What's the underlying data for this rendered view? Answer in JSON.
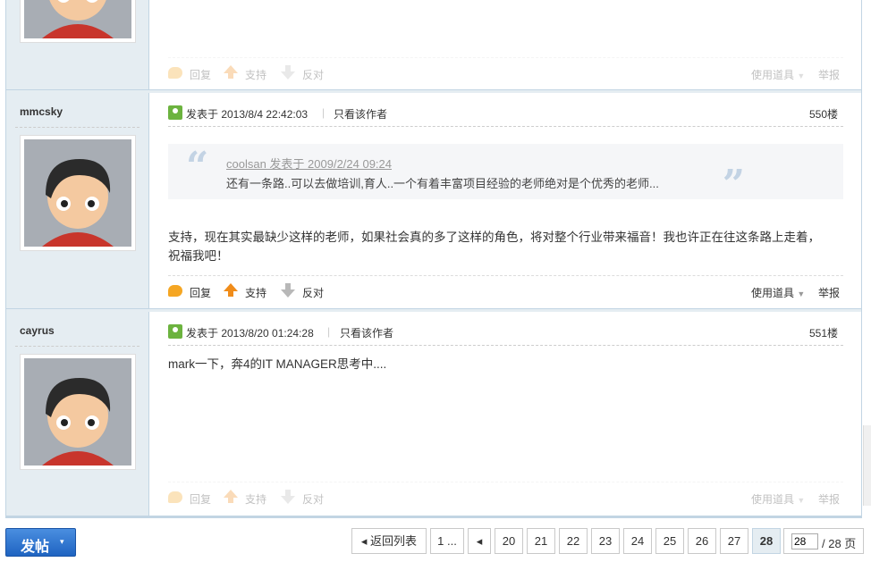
{
  "post_prev": {
    "actions": {
      "reply": "回复",
      "support": "支持",
      "oppose": "反对",
      "tools": "使用道具",
      "report": "举报"
    }
  },
  "post_550": {
    "author": "mmcsky",
    "posted_at": "发表于 2013/8/4 22:42:03",
    "only_author": "只看该作者",
    "floor": "550楼",
    "quote": {
      "head": "coolsan 发表于 2009/2/24 09:24",
      "body": "还有一条路..可以去做培训,育人..一个有着丰富项目经验的老师绝对是个优秀的老师..."
    },
    "message_line1": "支持，现在其实最缺少这样的老师，如果社会真的多了这样的角色，将对整个行业带来福音！我也许正在往这条路上走着，",
    "message_line2": "祝福我吧！",
    "actions": {
      "reply": "回复",
      "support": "支持",
      "oppose": "反对",
      "tools": "使用道具",
      "report": "举报"
    }
  },
  "post_551": {
    "author": "cayrus",
    "posted_at": "发表于 2013/8/20 01:24:28",
    "only_author": "只看该作者",
    "floor": "551楼",
    "message": "mark一下，奔4的IT MANAGER思考中....",
    "actions": {
      "reply": "回复",
      "support": "支持",
      "oppose": "反对",
      "tools": "使用道具",
      "report": "举报"
    }
  },
  "post_button": {
    "label": "发帖",
    "caret": "▾"
  },
  "pager": {
    "back": "◂ 返回列表",
    "first": "1 ...",
    "prev": "◂",
    "pages": [
      "20",
      "21",
      "22",
      "23",
      "24",
      "25",
      "26",
      "27"
    ],
    "current": "28",
    "input_value": "28",
    "total": "/ 28 页"
  },
  "colors": {
    "sidebar_bg": "#e5edf2",
    "border": "#c2d5e3",
    "post_button": "#2a6fce"
  }
}
